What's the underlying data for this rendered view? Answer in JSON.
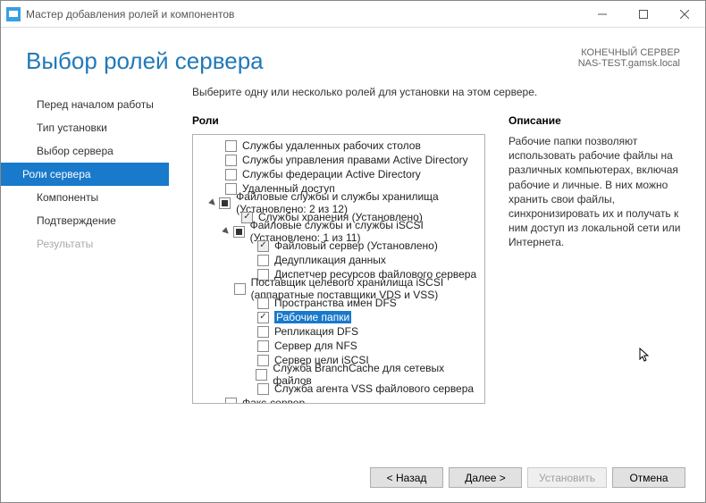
{
  "window": {
    "title": "Мастер добавления ролей и компонентов"
  },
  "header": {
    "title": "Выбор ролей сервера",
    "dest_label": "КОНЕЧНЫЙ СЕРВЕР",
    "dest_value": "NAS-TEST.gamsk.local"
  },
  "nav": {
    "items": [
      {
        "label": "Перед началом работы",
        "state": "normal"
      },
      {
        "label": "Тип установки",
        "state": "normal"
      },
      {
        "label": "Выбор сервера",
        "state": "normal"
      },
      {
        "label": "Роли сервера",
        "state": "active"
      },
      {
        "label": "Компоненты",
        "state": "normal"
      },
      {
        "label": "Подтверждение",
        "state": "normal"
      },
      {
        "label": "Результаты",
        "state": "disabled"
      }
    ]
  },
  "main": {
    "instruction": "Выберите одну или несколько ролей для установки на этом сервере.",
    "roles_heading": "Роли",
    "description_heading": "Описание",
    "description_text": "Рабочие папки позволяют использовать рабочие файлы на различных компьютерах, включая рабочие и личные. В них можно хранить свои файлы, синхронизировать их и получать к ним доступ из локальной сети или Интернета."
  },
  "tree": [
    {
      "indent": 0,
      "cb": "empty",
      "label": "Службы удаленных рабочих столов"
    },
    {
      "indent": 0,
      "cb": "empty",
      "label": "Службы управления правами Active Directory"
    },
    {
      "indent": 0,
      "cb": "empty",
      "label": "Службы федерации Active Directory"
    },
    {
      "indent": 0,
      "cb": "empty",
      "label": "Удаленный доступ"
    },
    {
      "indent": 0,
      "cb": "tristate",
      "label": "Файловые службы и службы хранилища (Установлено: 2 из 12)",
      "expander": "open"
    },
    {
      "indent": 1,
      "cb": "checked",
      "label": "Службы хранения (Установлено)",
      "disabled": true
    },
    {
      "indent": 1,
      "cb": "tristate",
      "label": "Файловые службы и службы iSCSI (Установлено: 1 из 11)",
      "expander": "open"
    },
    {
      "indent": 2,
      "cb": "checked",
      "label": "Файловый сервер (Установлено)",
      "disabled": true
    },
    {
      "indent": 2,
      "cb": "empty",
      "label": "Дедупликация данных"
    },
    {
      "indent": 2,
      "cb": "empty",
      "label": "Диспетчер ресурсов файлового сервера"
    },
    {
      "indent": 2,
      "cb": "empty",
      "label": "Поставщик целевого хранилища iSCSI (аппаратные поставщики VDS и VSS)"
    },
    {
      "indent": 2,
      "cb": "empty",
      "label": "Пространства имен DFS"
    },
    {
      "indent": 2,
      "cb": "checked",
      "label": "Рабочие папки",
      "selected": true
    },
    {
      "indent": 2,
      "cb": "empty",
      "label": "Репликация DFS"
    },
    {
      "indent": 2,
      "cb": "empty",
      "label": "Сервер для NFS"
    },
    {
      "indent": 2,
      "cb": "empty",
      "label": "Сервер цели iSCSI"
    },
    {
      "indent": 2,
      "cb": "empty",
      "label": "Служба BranchCache для сетевых файлов"
    },
    {
      "indent": 2,
      "cb": "empty",
      "label": "Служба агента VSS файлового сервера"
    },
    {
      "indent": 0,
      "cb": "empty",
      "label": "Факс-сервер"
    }
  ],
  "buttons": {
    "back": "< Назад",
    "next": "Далее >",
    "install": "Установить",
    "cancel": "Отмена"
  }
}
